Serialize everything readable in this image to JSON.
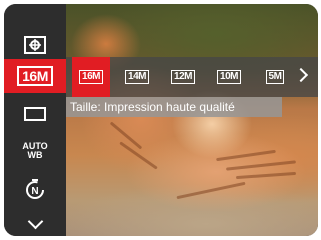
{
  "sidebar": {
    "items": [
      {
        "icon": "metering-icon"
      },
      {
        "icon": "resolution-icon",
        "label": "16M",
        "active": true
      },
      {
        "icon": "quality-rectangle-icon"
      },
      {
        "icon": "white-balance-icon",
        "label": "AUTO\nWB"
      },
      {
        "icon": "self-timer-icon",
        "label": "N"
      },
      {
        "icon": "chevron-down-icon"
      }
    ],
    "wb_line1": "AUTO",
    "wb_line2": "WB"
  },
  "resolution_options": [
    {
      "label": "16M",
      "selected": true
    },
    {
      "label": "14M",
      "selected": false
    },
    {
      "label": "12M",
      "selected": false
    },
    {
      "label": "10M",
      "selected": false
    },
    {
      "label": "5M",
      "selected": false
    }
  ],
  "more_icon": "chevron-right-icon",
  "caption": "Taille: Impression haute qualité",
  "colors": {
    "accent": "#e11d23",
    "sidebar": "#2d2d2d",
    "strip": "#464646"
  }
}
